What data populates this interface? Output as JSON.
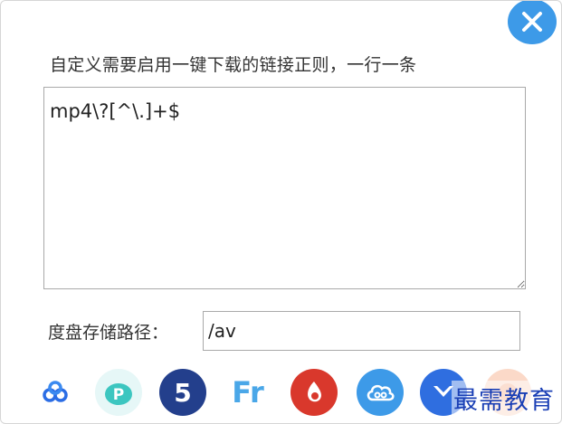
{
  "dialog": {
    "instruction": "自定义需要启用一键下载的链接正则，一行一条",
    "regex_value": "mp4\\?[^\\.]+$",
    "path_label": "度盘存储路径：",
    "path_value": "/av"
  },
  "app_icons": [
    {
      "name": "baidu-netdisk-logo-icon",
      "color": "#2b6de5"
    },
    {
      "name": "pikpak-icon",
      "color": "#3cc6c0"
    },
    {
      "name": "five-s-icon",
      "color": "#233f8c",
      "text": "5"
    },
    {
      "name": "fr-icon",
      "color": "#4aa7e8",
      "text": "Fr"
    },
    {
      "name": "red-app-icon",
      "color": "#d9382c"
    },
    {
      "name": "cloud-icon",
      "color": "#3d9ae8"
    },
    {
      "name": "blue-bird-icon",
      "color": "#2f6ee0"
    },
    {
      "name": "orange-app-icon",
      "color": "#f7b99a"
    }
  ],
  "watermark": "最需教育"
}
